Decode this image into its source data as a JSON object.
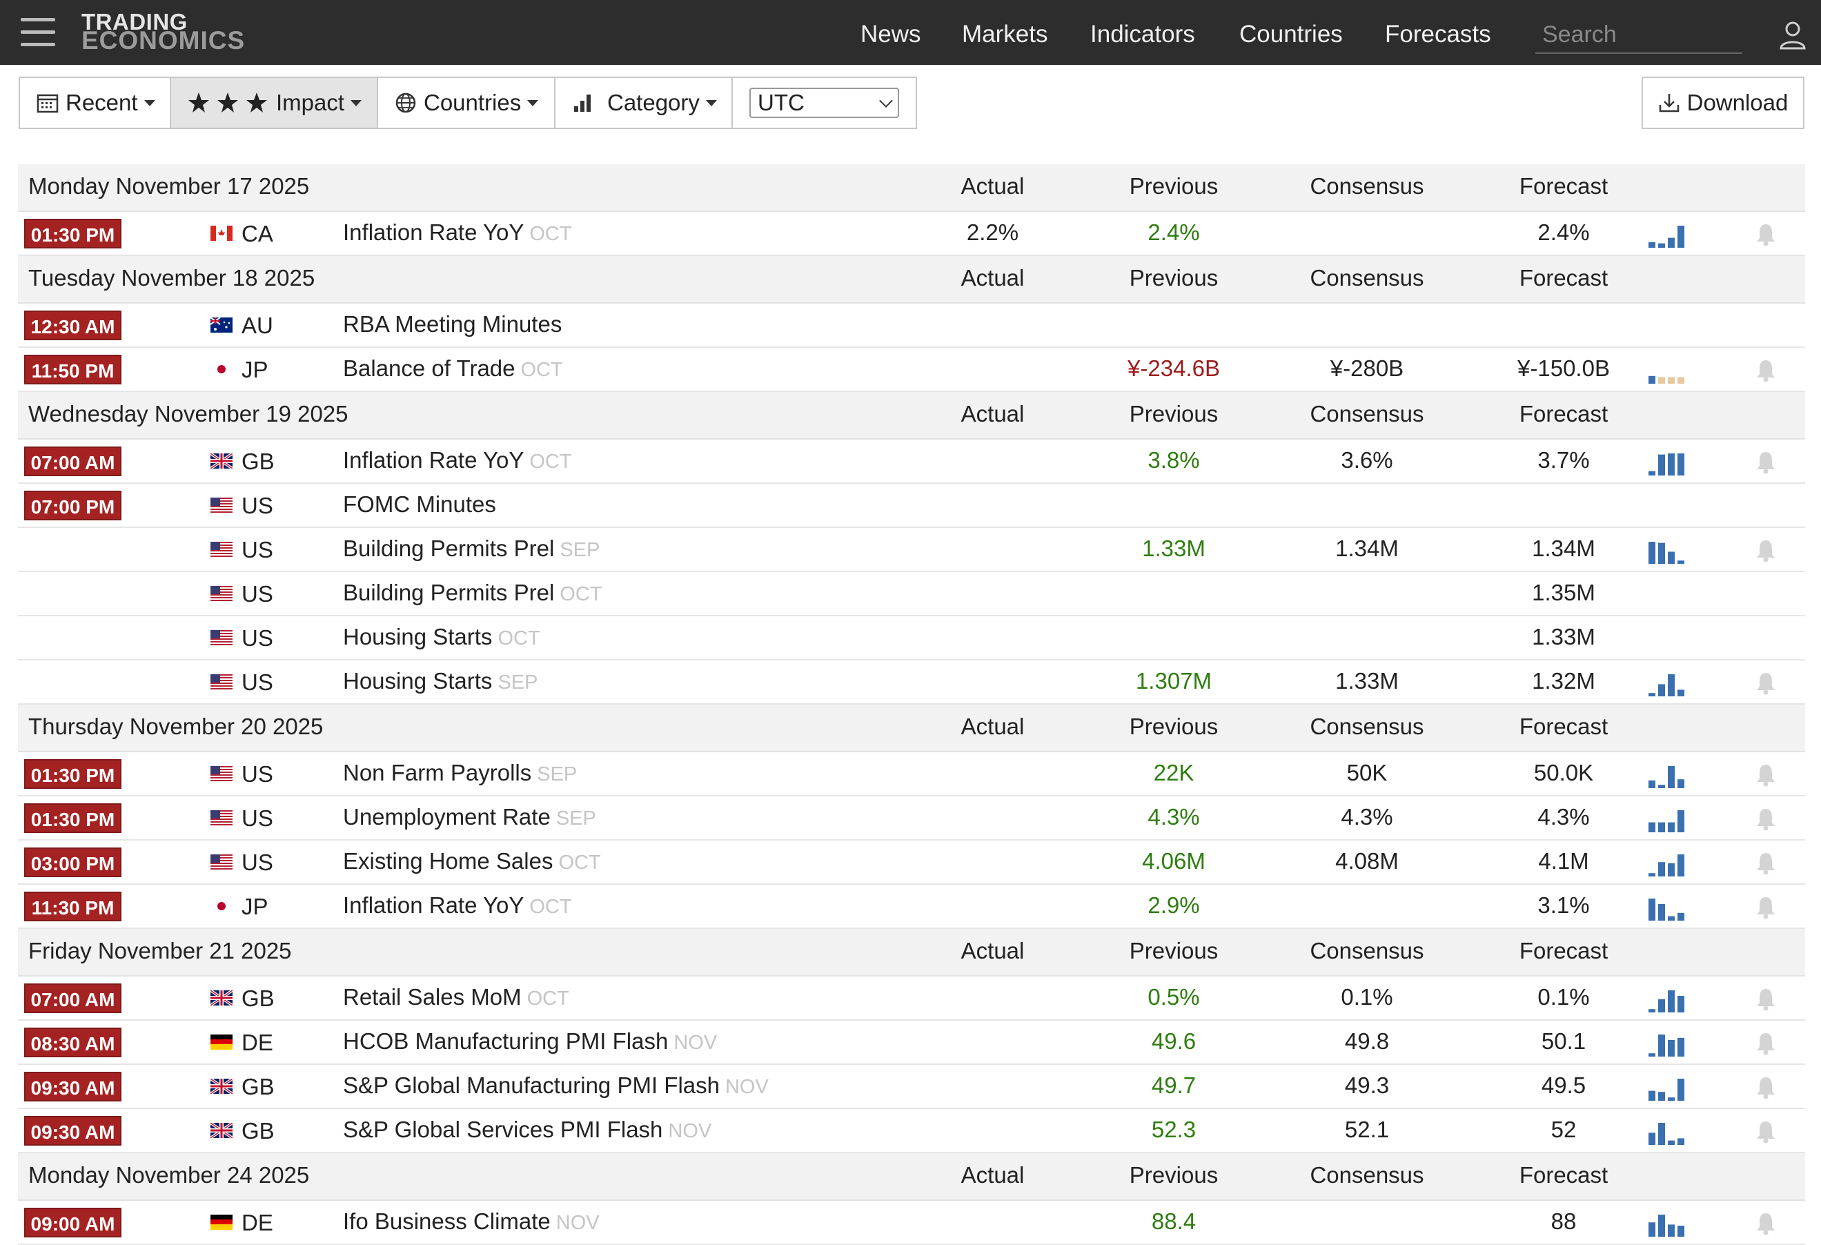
{
  "brand": {
    "line1": "TRADING",
    "line2": "ECONOMICS"
  },
  "nav": {
    "news": "News",
    "markets": "Markets",
    "indicators": "Indicators",
    "countries": "Countries",
    "forecasts": "Forecasts",
    "search_placeholder": "Search"
  },
  "toolbar": {
    "recent": "Recent",
    "impact": "Impact",
    "countries": "Countries",
    "category": "Category",
    "timezone": "UTC",
    "download": "Download"
  },
  "columns": {
    "actual": "Actual",
    "previous": "Previous",
    "consensus": "Consensus",
    "forecast": "Forecast"
  },
  "colors": {
    "time_badge": "#a52222",
    "positive": "#2e7d0f",
    "negative": "#9c1b1b",
    "spark_blue": "#3a6fb0",
    "spark_beige": "#e8c9a0"
  },
  "days": [
    {
      "date": "Monday November 17 2025",
      "events": [
        {
          "time": "01:30 PM",
          "country": "CA",
          "flag": "ca",
          "event": "Inflation Rate YoY",
          "ref": "OCT",
          "actual": "2.2%",
          "previous": "2.4%",
          "consensus": "",
          "forecast": "2.4%",
          "spark": [
            0.25,
            0.2,
            0.45,
            1.0
          ],
          "spark_color": "blue",
          "bell": true
        }
      ]
    },
    {
      "date": "Tuesday November 18 2025",
      "events": [
        {
          "time": "12:30 AM",
          "country": "AU",
          "flag": "au",
          "event": "RBA Meeting Minutes",
          "ref": "",
          "actual": "",
          "previous": "",
          "consensus": "",
          "forecast": "",
          "spark": null,
          "bell": false
        },
        {
          "time": "11:50 PM",
          "country": "JP",
          "flag": "jp",
          "event": "Balance of Trade",
          "ref": "OCT",
          "actual": "",
          "previous": "¥-234.6B",
          "previous_neg": true,
          "consensus": "¥-280B",
          "forecast": "¥-150.0B",
          "spark": [
            0.35,
            0.3,
            0.3,
            0.3
          ],
          "spark_color": "mixed",
          "bell": true
        }
      ]
    },
    {
      "date": "Wednesday November 19 2025",
      "events": [
        {
          "time": "07:00 AM",
          "country": "GB",
          "flag": "gb",
          "event": "Inflation Rate YoY",
          "ref": "OCT",
          "actual": "",
          "previous": "3.8%",
          "consensus": "3.6%",
          "forecast": "3.7%",
          "spark": [
            0.2,
            0.95,
            1.0,
            1.0
          ],
          "spark_color": "blue",
          "bell": true
        },
        {
          "time": "07:00 PM",
          "country": "US",
          "flag": "us",
          "event": "FOMC Minutes",
          "ref": "",
          "actual": "",
          "previous": "",
          "consensus": "",
          "forecast": "",
          "spark": null,
          "bell": false
        },
        {
          "time": "",
          "country": "US",
          "flag": "us",
          "event": "Building Permits Prel",
          "ref": "SEP",
          "actual": "",
          "previous": "1.33M",
          "consensus": "1.34M",
          "forecast": "1.34M",
          "spark": [
            1.0,
            0.95,
            0.55,
            0.15
          ],
          "spark_color": "blue",
          "bell": true
        },
        {
          "time": "",
          "country": "US",
          "flag": "us",
          "event": "Building Permits Prel",
          "ref": "OCT",
          "actual": "",
          "previous": "",
          "consensus": "",
          "forecast": "1.35M",
          "spark": null,
          "bell": false
        },
        {
          "time": "",
          "country": "US",
          "flag": "us",
          "event": "Housing Starts",
          "ref": "OCT",
          "actual": "",
          "previous": "",
          "consensus": "",
          "forecast": "1.33M",
          "spark": null,
          "bell": false
        },
        {
          "time": "",
          "country": "US",
          "flag": "us",
          "event": "Housing Starts",
          "ref": "SEP",
          "actual": "",
          "previous": "1.307M",
          "consensus": "1.33M",
          "forecast": "1.32M",
          "spark": [
            0.15,
            0.55,
            1.0,
            0.3
          ],
          "spark_color": "blue",
          "bell": true
        }
      ]
    },
    {
      "date": "Thursday November 20 2025",
      "events": [
        {
          "time": "01:30 PM",
          "country": "US",
          "flag": "us",
          "event": "Non Farm Payrolls",
          "ref": "SEP",
          "actual": "",
          "previous": "22K",
          "consensus": "50K",
          "forecast": "50.0K",
          "spark": [
            0.35,
            0.15,
            1.0,
            0.4
          ],
          "spark_color": "blue",
          "bell": true
        },
        {
          "time": "01:30 PM",
          "country": "US",
          "flag": "us",
          "event": "Unemployment Rate",
          "ref": "SEP",
          "actual": "",
          "previous": "4.3%",
          "consensus": "4.3%",
          "forecast": "4.3%",
          "spark": [
            0.45,
            0.45,
            0.45,
            1.0
          ],
          "spark_color": "blue",
          "bell": true
        },
        {
          "time": "03:00 PM",
          "country": "US",
          "flag": "us",
          "event": "Existing Home Sales",
          "ref": "OCT",
          "actual": "",
          "previous": "4.06M",
          "consensus": "4.08M",
          "forecast": "4.1M",
          "spark": [
            0.15,
            0.65,
            0.6,
            1.0
          ],
          "spark_color": "blue",
          "bell": true
        },
        {
          "time": "11:30 PM",
          "country": "JP",
          "flag": "jp",
          "event": "Inflation Rate YoY",
          "ref": "OCT",
          "actual": "",
          "previous": "2.9%",
          "consensus": "",
          "forecast": "3.1%",
          "spark": [
            1.0,
            0.75,
            0.2,
            0.35
          ],
          "spark_color": "blue",
          "bell": true
        }
      ]
    },
    {
      "date": "Friday November 21 2025",
      "events": [
        {
          "time": "07:00 AM",
          "country": "GB",
          "flag": "gb",
          "event": "Retail Sales MoM",
          "ref": "OCT",
          "actual": "",
          "previous": "0.5%",
          "consensus": "0.1%",
          "forecast": "0.1%",
          "spark": [
            0.15,
            0.6,
            1.0,
            0.75
          ],
          "spark_color": "blue",
          "bell": true
        },
        {
          "time": "08:30 AM",
          "country": "DE",
          "flag": "de",
          "event": "HCOB Manufacturing PMI Flash",
          "ref": "NOV",
          "actual": "",
          "previous": "49.6",
          "consensus": "49.8",
          "forecast": "50.1",
          "spark": [
            0.15,
            1.0,
            0.75,
            0.85
          ],
          "spark_color": "blue",
          "bell": true
        },
        {
          "time": "09:30 AM",
          "country": "GB",
          "flag": "gb",
          "event": "S&P Global Manufacturing PMI Flash",
          "ref": "NOV",
          "actual": "",
          "previous": "49.7",
          "consensus": "49.3",
          "forecast": "49.5",
          "spark": [
            0.45,
            0.4,
            0.15,
            1.0
          ],
          "spark_color": "blue",
          "bell": true
        },
        {
          "time": "09:30 AM",
          "country": "GB",
          "flag": "gb",
          "event": "S&P Global Services PMI Flash",
          "ref": "NOV",
          "actual": "",
          "previous": "52.3",
          "consensus": "52.1",
          "forecast": "52",
          "spark": [
            0.55,
            1.0,
            0.2,
            0.3
          ],
          "spark_color": "blue",
          "bell": true
        }
      ]
    },
    {
      "date": "Monday November 24 2025",
      "events": [
        {
          "time": "09:00 AM",
          "country": "DE",
          "flag": "de",
          "event": "Ifo Business Climate",
          "ref": "NOV",
          "actual": "",
          "previous": "88.4",
          "consensus": "",
          "forecast": "88",
          "spark": [
            0.65,
            1.0,
            0.55,
            0.5
          ],
          "spark_color": "blue",
          "bell": true
        }
      ]
    }
  ]
}
